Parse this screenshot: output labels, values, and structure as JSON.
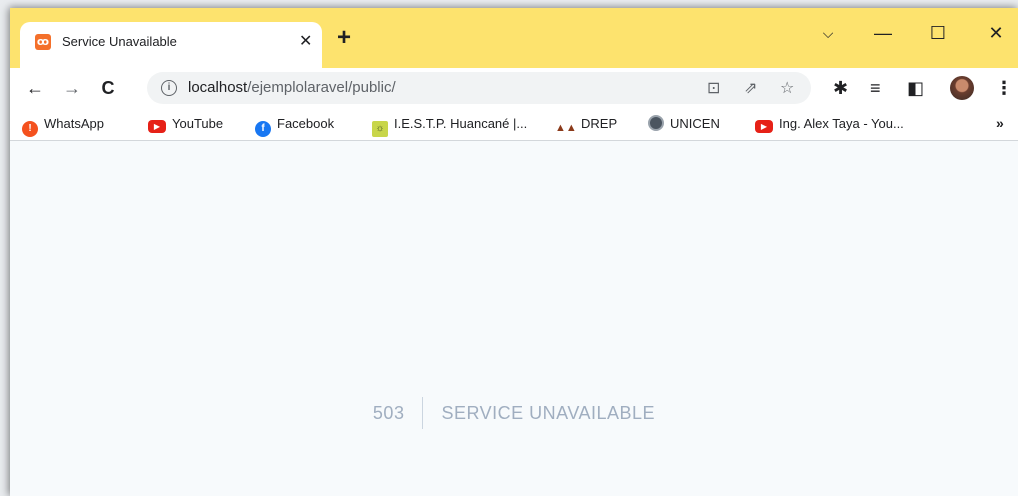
{
  "browser": {
    "tab": {
      "title": "Service Unavailable",
      "favicon": "xampp-icon"
    },
    "new_tab": "+",
    "window_controls": {
      "minimize": "—",
      "maximize": "☐",
      "close": "✕",
      "tab_search": "⌵"
    },
    "address": {
      "host": "localhost",
      "path": "/ejemplolaravel/public/"
    },
    "bookmarks": [
      {
        "label": "WhatsApp",
        "icon": "whatsapp-icon"
      },
      {
        "label": "YouTube",
        "icon": "youtube-icon"
      },
      {
        "label": "Facebook",
        "icon": "facebook-icon"
      },
      {
        "label": "I.E.S.T.P. Huancané |...",
        "icon": "iestp-icon"
      },
      {
        "label": "DREP",
        "icon": "drep-icon"
      },
      {
        "label": "UNICEN",
        "icon": "unicen-icon"
      },
      {
        "label": "Ing. Alex Taya - You...",
        "icon": "youtube-icon"
      }
    ],
    "bookmarks_more": "»"
  },
  "page": {
    "error_code": "503",
    "error_message": "SERVICE UNAVAILABLE"
  },
  "colors": {
    "titlebar": "#fde36e",
    "page_bg": "#f7fafc",
    "error_text": "#a0aec0"
  }
}
